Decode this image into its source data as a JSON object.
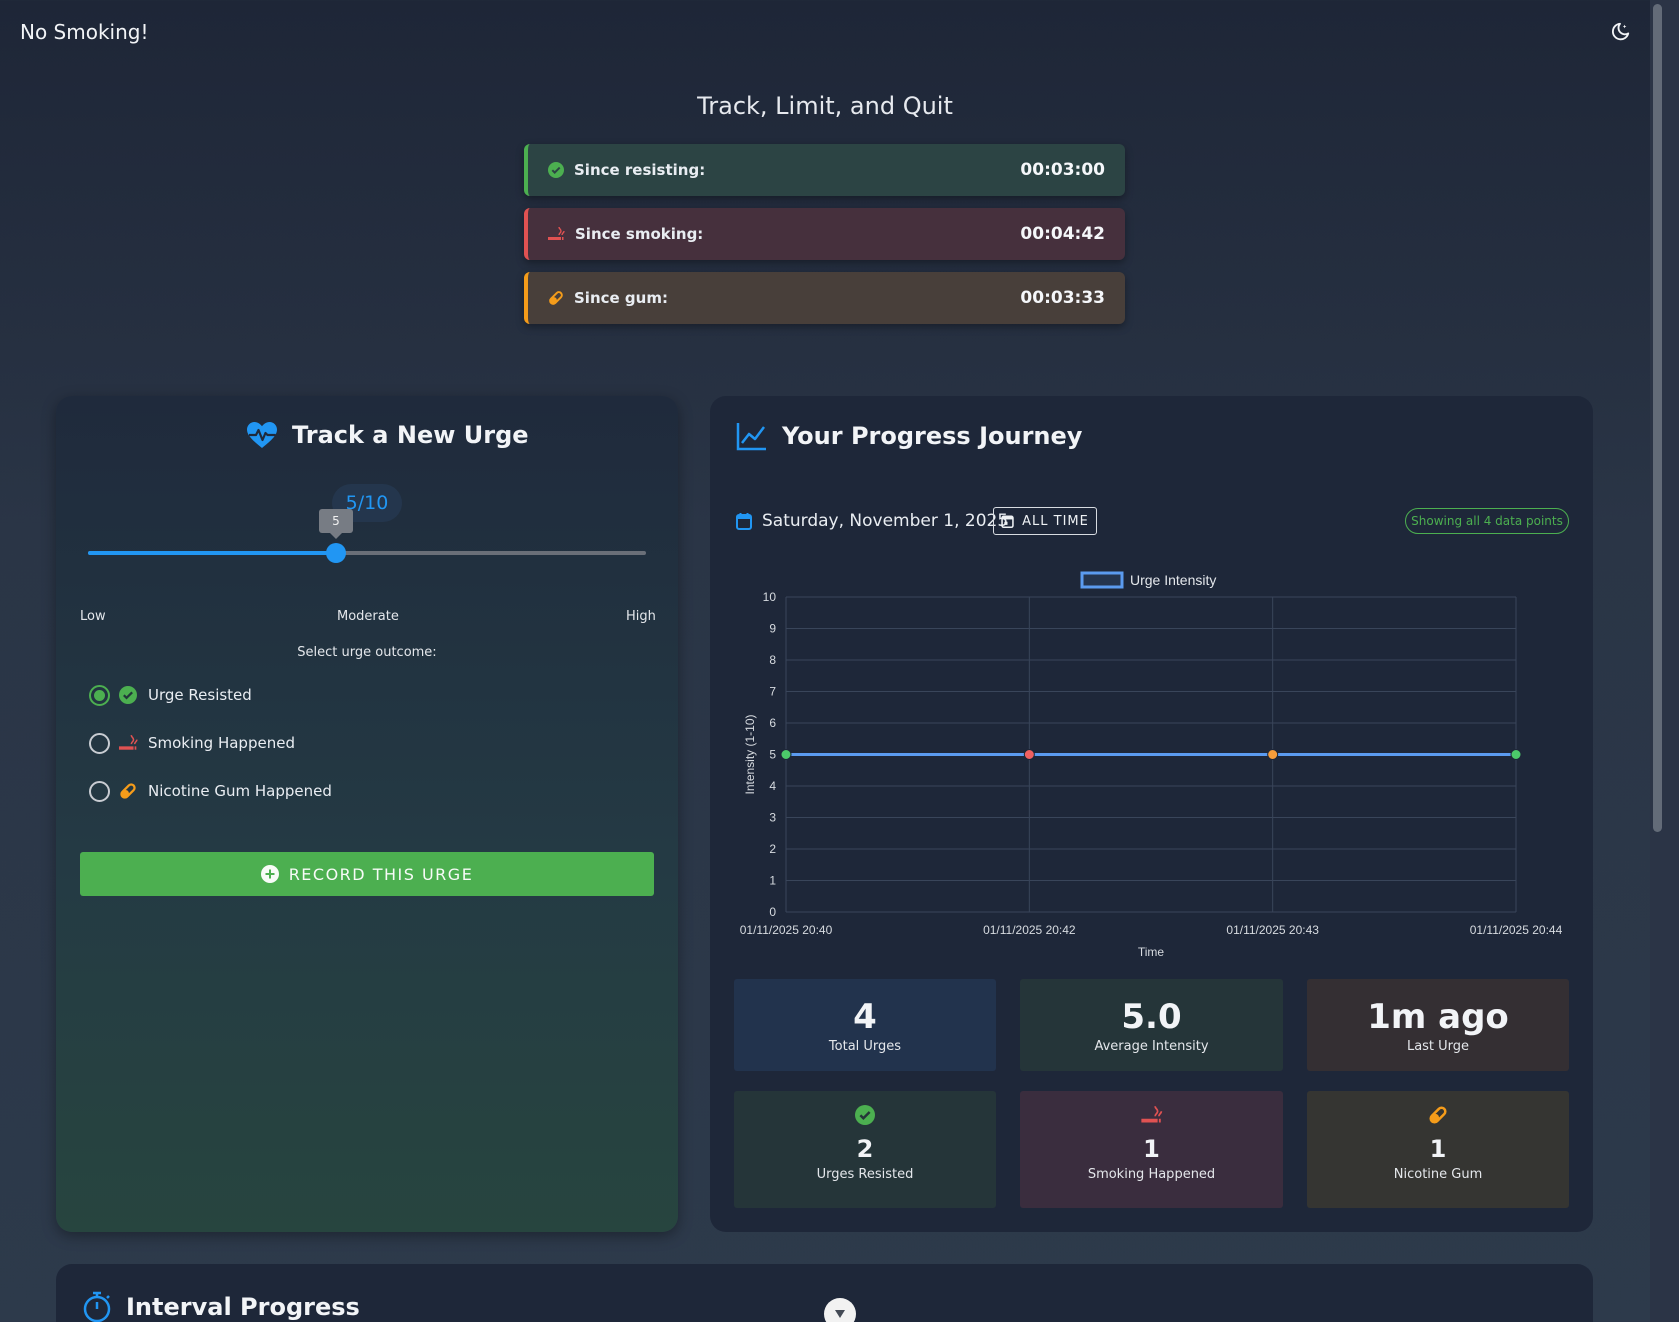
{
  "app": {
    "title": "No Smoking!",
    "theme_toggle_icon": "moon-icon"
  },
  "tagline": "Track, Limit, and Quit",
  "timers": {
    "resisting": {
      "label": "Since resisting:",
      "value": "00:03:00",
      "icon": "check-circle-icon",
      "color": "#4caf50"
    },
    "smoking": {
      "label": "Since smoking:",
      "value": "00:04:42",
      "icon": "smoking-icon",
      "color": "#e05252"
    },
    "gum": {
      "label": "Since gum:",
      "value": "00:03:33",
      "icon": "pill-icon",
      "color": "#f59c1a"
    }
  },
  "track": {
    "title": "Track a New Urge",
    "intensity_display": "5/10",
    "intensity": 5,
    "intensity_max": 10,
    "slider_tooltip": "5",
    "scale": {
      "low": "Low",
      "moderate": "Moderate",
      "high": "High"
    },
    "outcome_prompt": "Select urge outcome:",
    "outcomes": [
      {
        "label": "Urge Resisted",
        "checked": true,
        "icon": "check-circle-icon"
      },
      {
        "label": "Smoking Happened",
        "checked": false,
        "icon": "smoking-icon"
      },
      {
        "label": "Nicotine Gum Happened",
        "checked": false,
        "icon": "pill-icon"
      }
    ],
    "record_button": "RECORD THIS URGE"
  },
  "progress": {
    "title": "Your Progress Journey",
    "date": "Saturday, November 1, 2025",
    "range_button": "ALL TIME",
    "points_badge": "Showing all 4 data points"
  },
  "chart_data": {
    "type": "line",
    "legend": [
      "Urge Intensity"
    ],
    "legend_placement": "top-center",
    "xlabel": "Time",
    "ylabel": "Intensity (1-10)",
    "ylim": [
      0,
      10
    ],
    "yticks": [
      "0",
      "1",
      "2",
      "3",
      "4",
      "5",
      "6",
      "7",
      "8",
      "9",
      "10"
    ],
    "grid": true,
    "x": [
      "01/11/2025 20:40",
      "01/11/2025 20:42",
      "01/11/2025 20:43",
      "01/11/2025 20:44"
    ],
    "series": [
      {
        "name": "Urge Intensity",
        "values": [
          5,
          5,
          5,
          5
        ],
        "line_color": "#5b9bf0",
        "point_colors": [
          "#4cc96a",
          "#f06060",
          "#f59c3a",
          "#4cc96a"
        ]
      }
    ]
  },
  "stats": {
    "total": {
      "value": "4",
      "label": "Total Urges"
    },
    "average": {
      "value": "5.0",
      "label": "Average Intensity"
    },
    "last": {
      "value": "1m ago",
      "label": "Last Urge"
    },
    "resisted": {
      "value": "2",
      "label": "Urges Resisted"
    },
    "smoking": {
      "value": "1",
      "label": "Smoking Happened"
    },
    "gum": {
      "value": "1",
      "label": "Nicotine Gum"
    }
  },
  "interval": {
    "title": "Interval Progress"
  }
}
